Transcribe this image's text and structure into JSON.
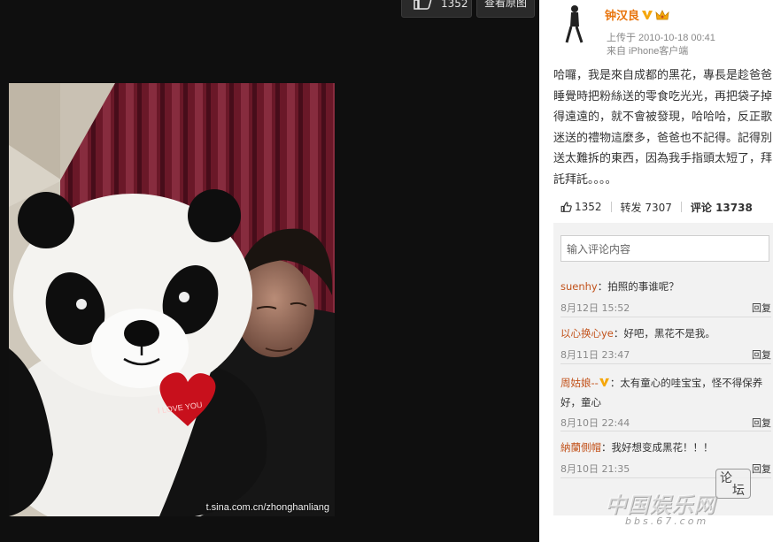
{
  "toolbar": {
    "like_count": "1352",
    "view_original_label": "查看原图"
  },
  "photo": {
    "watermark": "t.sina.com.cn/zhonghanliang",
    "heart_label": "I LOVE YOU"
  },
  "post": {
    "author": "钟汉良",
    "uploaded": "上传于 2010-10-18 00:41",
    "source": "来自 iPhone客户端",
    "text": "哈囉，我是來自成都的黑花，專長是趁爸爸睡覺時把粉絲送的零食吃光光，再把袋子掉得遠遠的，就不會被發現，哈哈哈，反正歌迷送的禮物這麼多，爸爸也不記得。記得別送太難拆的東西，因為我手指頭太短了，拜託拜託。。。。",
    "likes": "1352",
    "repost_label": "转发 7307",
    "comment_label": "评论 13738"
  },
  "comments": {
    "placeholder": "输入评论内容",
    "items": [
      {
        "user": "suenhy",
        "text": "：拍照的事谁呢？",
        "time": "8月12日 15:52",
        "reply": "回复",
        "verified": false
      },
      {
        "user": "以心换心ye",
        "text": "：好吧，黑花不是我。",
        "time": "8月11日 23:47",
        "reply": "回复",
        "verified": false
      },
      {
        "user": "周姑娘--",
        "text": "：太有童心的哇宝宝，怪不得保养好，童心",
        "time": "8月10日 22:44",
        "reply": "回复",
        "verified": true
      },
      {
        "user": "納蘭側帽",
        "text": "：我好想变成黑花！！！",
        "time": "8月10日 21:35",
        "reply": "回复",
        "verified": false
      }
    ]
  },
  "watermark_logo": {
    "site": "中国娱乐网",
    "url": "bbs.67.com",
    "badge_1": "论",
    "badge_2": "坛"
  },
  "colors": {
    "author": "#e8740c",
    "comment_user": "#c2521b",
    "verified_badge": "#f5a70b"
  }
}
